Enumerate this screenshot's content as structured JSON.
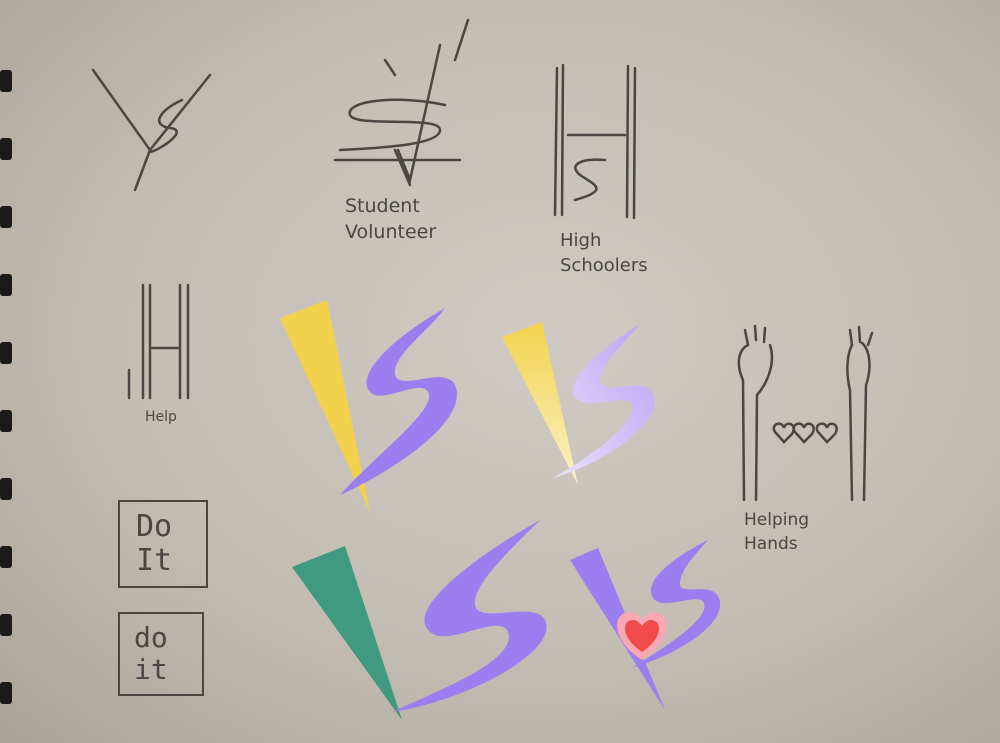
{
  "sketch": {
    "student_volunteer": [
      "Student",
      "Volunteer"
    ],
    "high_schoolers": [
      "High",
      "Schoolers"
    ],
    "help_label": "Help",
    "helping_hands": [
      "Helping",
      "Hands"
    ],
    "do_it_upper": [
      "Do",
      "It"
    ],
    "do_it_lower": [
      "do",
      "it"
    ]
  },
  "colors": {
    "paper": "#c9c4bc",
    "pencil": "#4a4643",
    "yellow": "#f2d24c",
    "purple": "#9b7ef0",
    "lavender": "#c2b0f5",
    "teal": "#3f9a80",
    "heart": "#f04a4a",
    "heart_glow": "#f7a8b3"
  }
}
